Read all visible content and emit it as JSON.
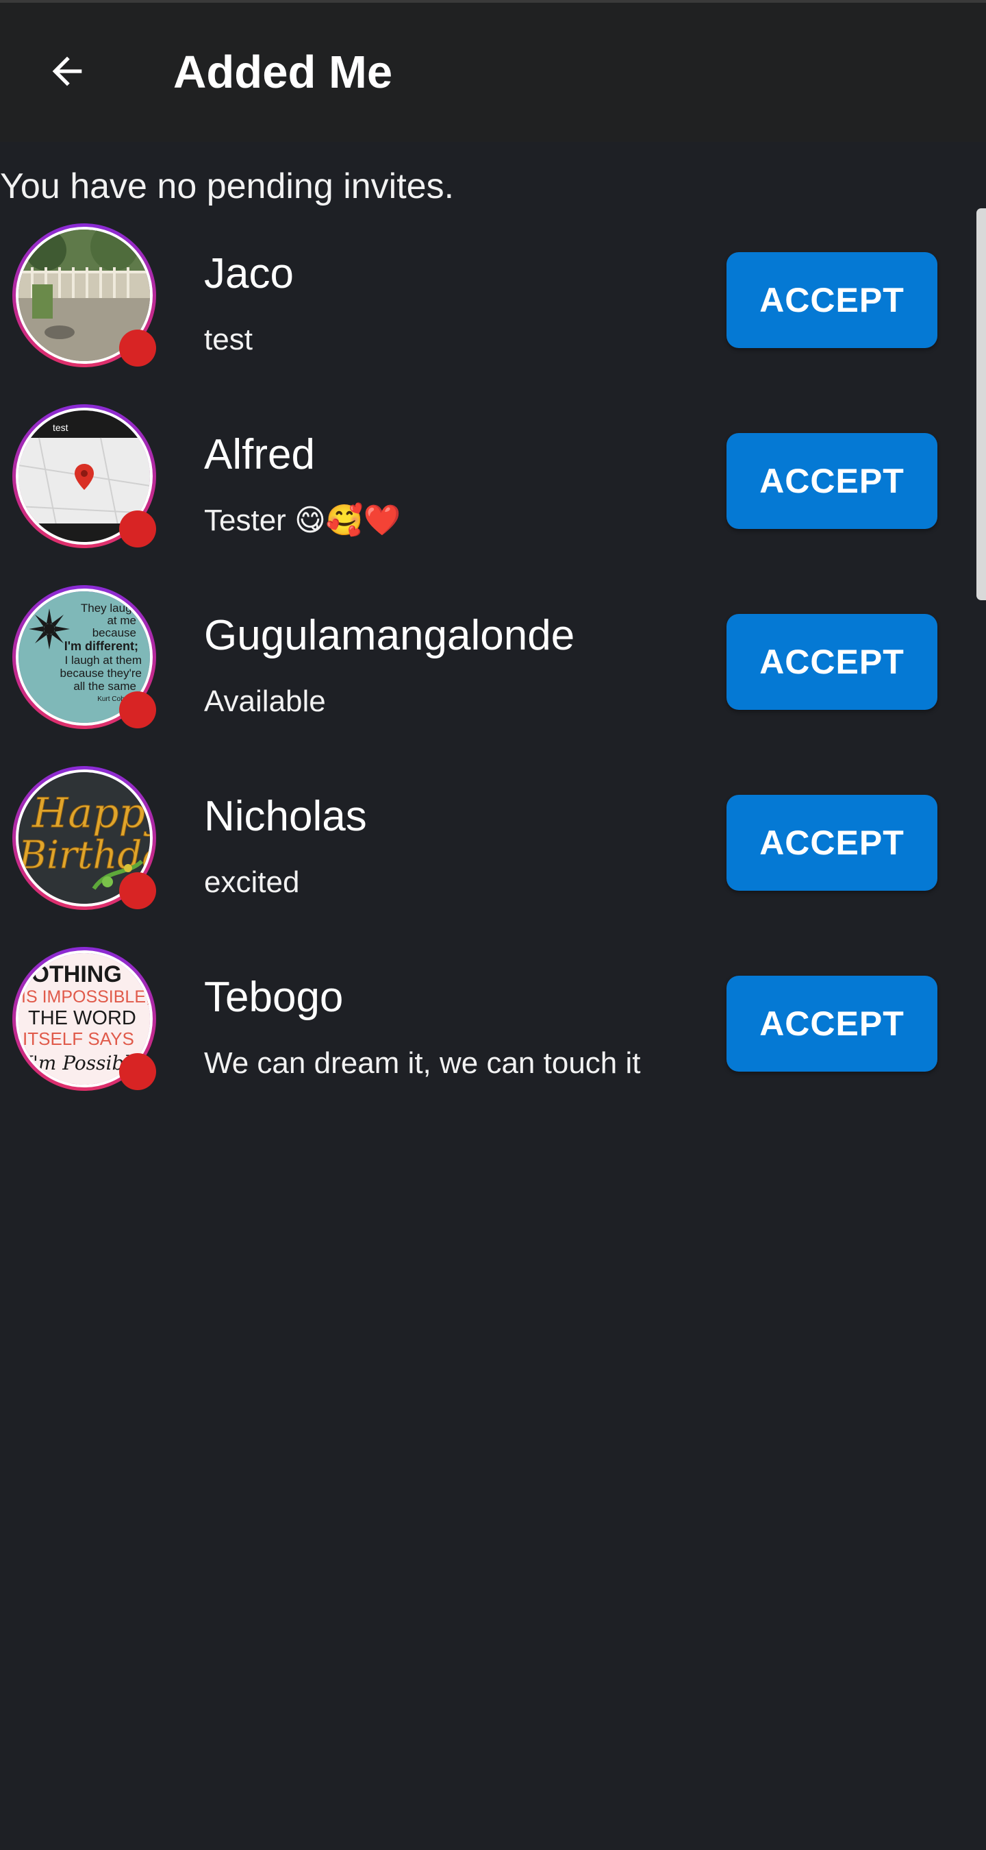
{
  "app_bar": {
    "title": "Added Me",
    "back_icon": "arrow-left-icon"
  },
  "notice": "You have no pending invites.",
  "colors": {
    "background": "#1e2025",
    "app_bar": "#202122",
    "accept_button": "#0579d4",
    "status_dot": "#d82424",
    "avatar_ring_top": "#8a2bd6",
    "avatar_ring_bottom": "#e0306a"
  },
  "invites": [
    {
      "name": "Jaco",
      "status": "test",
      "accept_label": "ACCEPT",
      "avatar": "photo-garden"
    },
    {
      "name": "Alfred",
      "status": "Tester 😋🥰❤️",
      "accept_label": "ACCEPT",
      "avatar": "map-screenshot"
    },
    {
      "name": "Gugulamangalonde",
      "status": "Available",
      "accept_label": "ACCEPT",
      "avatar": "quote-image"
    },
    {
      "name": "Nicholas",
      "status": "excited",
      "accept_label": "ACCEPT",
      "avatar": "happy-birthday-image"
    },
    {
      "name": "Tebogo",
      "status": "We can dream it, we can touch it",
      "accept_label": "ACCEPT",
      "avatar": "nothing-is-impossible-image"
    }
  ],
  "avatar_text": {
    "alfred_label": "test",
    "quote_lines": [
      "They laugh",
      "at me",
      "because",
      "I'm different;",
      "I laugh at them",
      "because they're",
      "all the same",
      "Kurt Cobain"
    ],
    "birthday_lines": [
      "Happy",
      "Birthday"
    ],
    "tebogo_lines": [
      "NOTHING",
      "IS IMPOSSIBLE,",
      "THE WORD",
      "ITSELF SAYS",
      "I'm Possible"
    ]
  }
}
